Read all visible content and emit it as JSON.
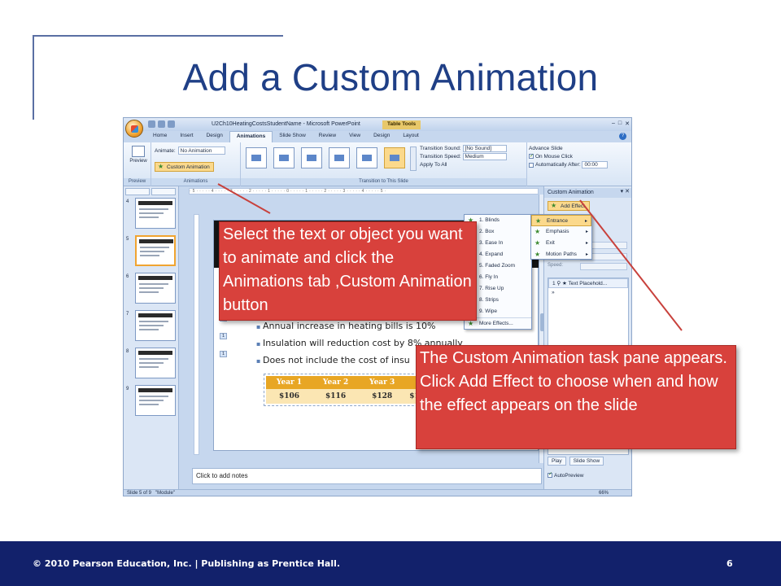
{
  "slide": {
    "title": "Add a Custom Animation",
    "footer": "© 2010 Pearson Education, Inc. | Publishing as Prentice Hall.",
    "page_number": "6"
  },
  "powerpoint": {
    "window_title": "U2Ch10HeatingCostsStudentName - Microsoft PowerPoint",
    "context_tab": "Table Tools",
    "tabs": [
      "Home",
      "Insert",
      "Design",
      "Animations",
      "Slide Show",
      "Review",
      "View",
      "Design",
      "Layout"
    ],
    "active_tab": "Animations",
    "ribbon": {
      "preview_label": "Preview",
      "animate_label": "Animate:",
      "animate_value": "No Animation",
      "custom_animation_label": "Custom Animation",
      "group_preview": "Preview",
      "group_animations": "Animations",
      "group_transition": "Transition to This Slide",
      "transition_sound_label": "Transition Sound:",
      "transition_sound_value": "[No Sound]",
      "transition_speed_label": "Transition Speed:",
      "transition_speed_value": "Medium",
      "apply_to_all": "Apply To All",
      "advance_slide": "Advance Slide",
      "on_mouse_click": "On Mouse Click",
      "auto_after": "Automatically After:",
      "auto_after_value": "00:00"
    },
    "thumbnails": [
      "4",
      "5",
      "6",
      "7",
      "8",
      "9"
    ],
    "selected_thumbnail": "5",
    "slide_content": {
      "anim_tags": [
        "1",
        "1",
        "1",
        "1",
        "1"
      ],
      "bullets": [
        "Annual increase in heating bills is 10%",
        "Insulation will reduction cost by 8% annually",
        "Does not include the cost of insu"
      ],
      "table_headers": [
        "Year 1",
        "Year 2",
        "Year 3",
        ""
      ],
      "table_values": [
        "$106",
        "$116",
        "$128",
        "$1"
      ]
    },
    "effect_menu": {
      "items": [
        "1. Blinds",
        "2. Box",
        "3. Ease In",
        "4. Expand",
        "5. Faded Zoom",
        "6. Fly In",
        "7. Rise Up",
        "8. Strips",
        "9. Wipe"
      ],
      "more": "More Effects..."
    },
    "submenu": {
      "items": [
        "Entrance",
        "Emphasis",
        "Exit",
        "Motion Paths"
      ],
      "highlighted": "Entrance"
    },
    "task_pane": {
      "title": "Custom Animation",
      "add_effect": "Add Effect",
      "speed_label": "Speed:",
      "list_item": "Text Placehold...",
      "play": "Play",
      "slide_show": "Slide Show",
      "autopreview": "AutoPreview"
    },
    "notes_placeholder": "Click to add notes",
    "status": {
      "slide_info": "Slide 5 of 9",
      "theme": "\"Module\"",
      "zoom": "66%"
    }
  },
  "callouts": {
    "select_text": "Select the text or object you want to animate and click the Animations tab ,Custom Animation button",
    "task_pane_text": "The Custom Animation task pane appears. Click Add Effect to choose when and how the effect appears on the slide"
  },
  "colors": {
    "title": "#1f3f86",
    "callout": "#d8413c",
    "footer_bar": "#12216b",
    "table_header": "#e8a624"
  }
}
